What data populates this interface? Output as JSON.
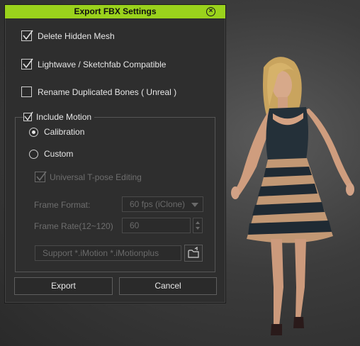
{
  "dialog": {
    "title": "Export FBX Settings",
    "close_icon": "close-circle-icon",
    "options": [
      {
        "label": "Delete Hidden Mesh",
        "checked": true
      },
      {
        "label": "Lightwave / Sketchfab Compatible",
        "checked": true
      },
      {
        "label": "Rename Duplicated Bones ( Unreal )",
        "checked": false
      }
    ],
    "motion": {
      "label": "Include Motion",
      "checked": true,
      "radios": [
        {
          "label": "Calibration",
          "selected": true
        },
        {
          "label": "Custom",
          "selected": false
        }
      ],
      "tpose_label": "Universal T-pose Editing",
      "tpose_checked": true,
      "frame_format_label": "Frame Format:",
      "frame_format_value": "60 fps (iClone)",
      "frame_rate_label": "Frame Rate(12~120)",
      "frame_rate_value": "60",
      "support_placeholder": "Support *.iMotion *.iMotionplus",
      "browse_icon": "folder-open-icon"
    },
    "buttons": {
      "export": "Export",
      "cancel": "Cancel"
    }
  },
  "colors": {
    "title_bar": "#9ad21c",
    "dialog_bg": "#2e2e2e",
    "viewport_bg": "#3c3c3c"
  }
}
